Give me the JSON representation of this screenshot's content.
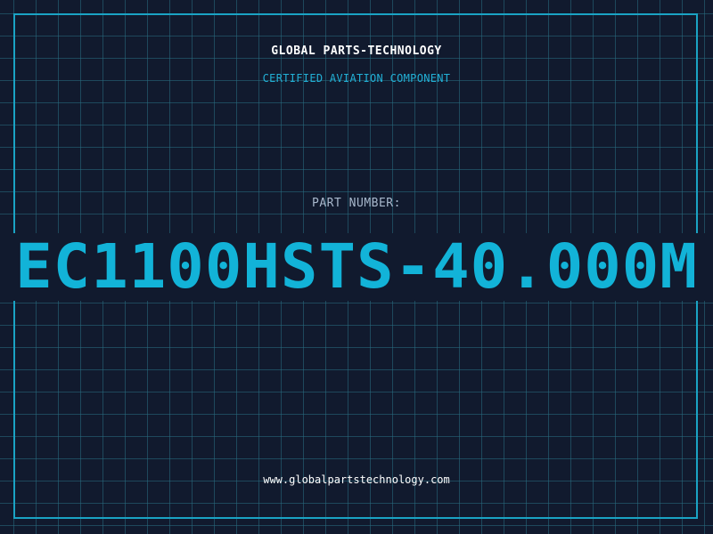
{
  "header": {
    "company": "GLOBAL PARTS-TECHNOLOGY",
    "tagline": "CERTIFIED AVIATION COMPONENT"
  },
  "part": {
    "label": "PART NUMBER:",
    "number": "EC1100HSTS-40.000M"
  },
  "footer": {
    "website": "www.globalpartstechnology.com"
  },
  "colors": {
    "background": "#111a2e",
    "accent": "#12b3d8",
    "grid": "#286e82",
    "frame": "#1aa3c4"
  }
}
